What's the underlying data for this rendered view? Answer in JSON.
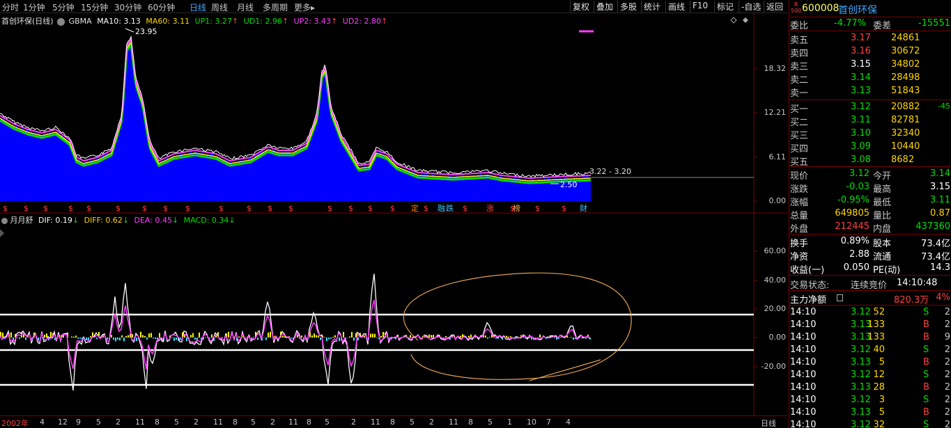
{
  "toolbar": {
    "tabs": [
      "分时",
      "1分钟",
      "5分钟",
      "15分钟",
      "30分钟",
      "60分钟",
      "日线",
      "周线",
      "月线",
      "多周期",
      "更多"
    ],
    "active_tab": "日线",
    "more_arrow": "▸",
    "right_buttons": [
      "复权",
      "叠加",
      "多股",
      "统计",
      "画线",
      "F10",
      "标记",
      "-自选",
      "返回"
    ]
  },
  "main_chart": {
    "title": "首创环保(日线)",
    "indicator": "GBMA",
    "ma10": "MA10: 3.13",
    "ma60": "MA60: 3.11",
    "up1": "UP1: 3.27",
    "ud1": "UD1: 2.96",
    "up2": "UP2: 3.43",
    "ud2": "UD2: 2.80",
    "high_label": "23.95",
    "low_label": "2.50",
    "range_label": "3.22 - 3.20",
    "y_ticks": [
      "18.32",
      "12.21",
      "6.11",
      "0.00"
    ],
    "event_markers": [
      "定",
      "融",
      "跌",
      "涨",
      "榜",
      "财"
    ]
  },
  "sub_chart": {
    "title": "月月舒",
    "dif": "DIF: 0.19",
    "diff": "DIFF: 0.62",
    "dea": "DEA: 0.45",
    "macd": "MACD: 0.34",
    "y_ticks": [
      "60.00",
      "40.00",
      "20.00",
      "0.00",
      "-20.00"
    ]
  },
  "x_axis": {
    "labels": [
      "2002年",
      "4",
      "12",
      "9",
      "5",
      "2",
      "11",
      "8",
      "5",
      "2",
      "11",
      "8",
      "5",
      "2",
      "11",
      "8",
      "5",
      "2",
      "11",
      "8",
      "5",
      "2",
      "11",
      "8",
      "5",
      "1",
      "10",
      "7",
      "4"
    ],
    "period_label": "日线"
  },
  "quote_panel": {
    "badge_top": "R",
    "badge_bottom": "500",
    "code": "600008",
    "name": "首创环保",
    "weibi_label": "委比",
    "weibi_value": "-4.77%",
    "weicha_label": "委差",
    "weicha_value": "-15551",
    "asks": [
      {
        "label": "卖五",
        "price": "3.17",
        "vol": "24861"
      },
      {
        "label": "卖四",
        "price": "3.16",
        "vol": "30672"
      },
      {
        "label": "卖三",
        "price": "3.15",
        "vol": "34802"
      },
      {
        "label": "卖二",
        "price": "3.14",
        "vol": "28498"
      },
      {
        "label": "卖一",
        "price": "3.13",
        "vol": "51843"
      }
    ],
    "bids": [
      {
        "label": "买一",
        "price": "3.12",
        "vol": "20882",
        "extra": "-45"
      },
      {
        "label": "买二",
        "price": "3.11",
        "vol": "82781",
        "extra": ""
      },
      {
        "label": "买三",
        "price": "3.10",
        "vol": "32340",
        "extra": ""
      },
      {
        "label": "买四",
        "price": "3.09",
        "vol": "10440",
        "extra": ""
      },
      {
        "label": "买五",
        "price": "3.08",
        "vol": "8682",
        "extra": ""
      }
    ],
    "stats": [
      {
        "l1": "现价",
        "v1": "3.12",
        "c1": "green",
        "l2": "今开",
        "v2": "3.14",
        "c2": "green"
      },
      {
        "l1": "涨跌",
        "v1": "-0.03",
        "c1": "green",
        "l2": "最高",
        "v2": "3.15",
        "c2": "white"
      },
      {
        "l1": "涨幅",
        "v1": "-0.95%",
        "c1": "green",
        "l2": "最低",
        "v2": "3.11",
        "c2": "green"
      },
      {
        "l1": "总量",
        "v1": "649805",
        "c1": "yellow",
        "l2": "量比",
        "v2": "0.87",
        "c2": "yellow"
      },
      {
        "l1": "外盘",
        "v1": "212445",
        "c1": "red",
        "l2": "内盘",
        "v2": "437360",
        "c2": "green"
      }
    ],
    "stats2": [
      {
        "l1": "换手",
        "v1": "0.89%",
        "l2": "股本",
        "v2": "73.4亿"
      },
      {
        "l1": "净资",
        "v1": "2.88",
        "l2": "流通",
        "v2": "73.4亿"
      },
      {
        "l1": "收益(一)",
        "v1": "0.050",
        "l2": "PE(动)",
        "v2": "14.3"
      }
    ],
    "trade_status_label": "交易状态:",
    "trade_status_value": "连续竞价",
    "trade_time": "14:10:48",
    "main_net_label": "主力净额",
    "main_net_value": "820.3万",
    "main_net_pct": "4%",
    "ticks": [
      {
        "t": "14:10",
        "p": "3.12",
        "v": "52",
        "s": "S",
        "n": "2"
      },
      {
        "t": "14:10",
        "p": "3.13",
        "v": "133",
        "s": "B",
        "n": "2"
      },
      {
        "t": "14:10",
        "p": "3.13",
        "v": "133",
        "s": "B",
        "n": "9"
      },
      {
        "t": "14:10",
        "p": "3.12",
        "v": "40",
        "s": "S",
        "n": "2"
      },
      {
        "t": "14:10",
        "p": "3.13",
        "v": "5",
        "s": "B",
        "n": "2"
      },
      {
        "t": "14:10",
        "p": "3.12",
        "v": "12",
        "s": "S",
        "n": "2"
      },
      {
        "t": "14:10",
        "p": "3.13",
        "v": "28",
        "s": "B",
        "n": "2"
      },
      {
        "t": "14:10",
        "p": "3.12",
        "v": "3",
        "s": "S",
        "n": "2"
      },
      {
        "t": "14:10",
        "p": "3.13",
        "v": "5",
        "s": "B",
        "n": "2"
      },
      {
        "t": "14:10",
        "p": "3.12",
        "v": "32",
        "s": "S",
        "n": "2"
      }
    ]
  }
}
